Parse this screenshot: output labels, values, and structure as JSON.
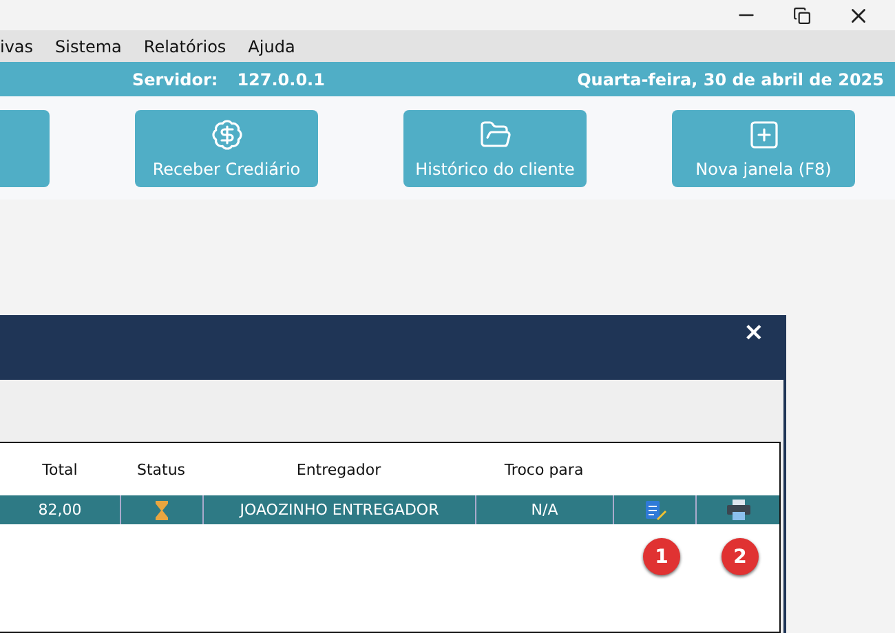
{
  "menu": [
    "ivas",
    "Sistema",
    "Relatórios",
    "Ajuda"
  ],
  "status_bar": {
    "server_label": "Servidor:",
    "server": "127.0.0.1",
    "date": "Quarta-feira, 30 de abril de 2025"
  },
  "toolbar": [
    {
      "kind": "partial"
    },
    {
      "label": "Receber Crediário",
      "kind": "money"
    },
    {
      "label": "Histórico do cliente",
      "kind": "folder"
    },
    {
      "label": "Nova janela (F8)",
      "kind": "new-window"
    }
  ],
  "dialog": {
    "close": "×",
    "table": {
      "columns": [
        "Total",
        "Status",
        "Entregador",
        "Troco para",
        null,
        null
      ],
      "rows": [
        {
          "total": "82,00",
          "pending": true,
          "entregador": "JOAOZINHO ENTREGADOR",
          "troco": "N/A",
          "selected": true
        }
      ]
    },
    "badges": [
      "1",
      "2"
    ]
  }
}
